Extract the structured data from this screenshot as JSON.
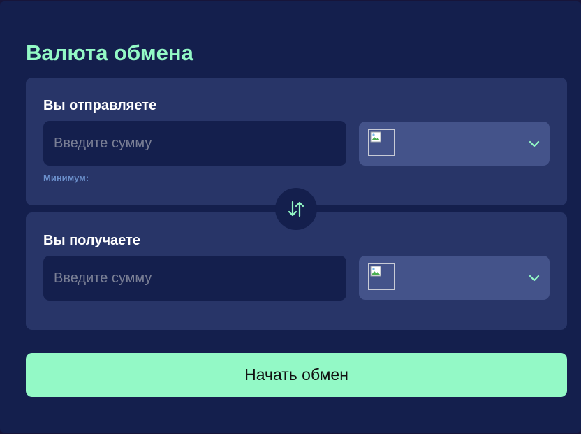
{
  "exchange": {
    "title": "Валюта обмена",
    "send": {
      "label": "Вы отправляете",
      "amount_placeholder": "Введите сумму",
      "minimum_label": "Минимум:"
    },
    "receive": {
      "label": "Вы получаете",
      "amount_placeholder": "Введите сумму"
    },
    "submit_label": "Начать обмен"
  },
  "icons": {
    "swap": "swap-arrows-icon",
    "dropdown": "chevron-down-icon",
    "currency": "broken-image-icon"
  },
  "colors": {
    "background": "#141f4d",
    "card": "#283568",
    "select": "#44538a",
    "accent": "#93f9c6",
    "minimum_text": "#6b8fcb"
  }
}
